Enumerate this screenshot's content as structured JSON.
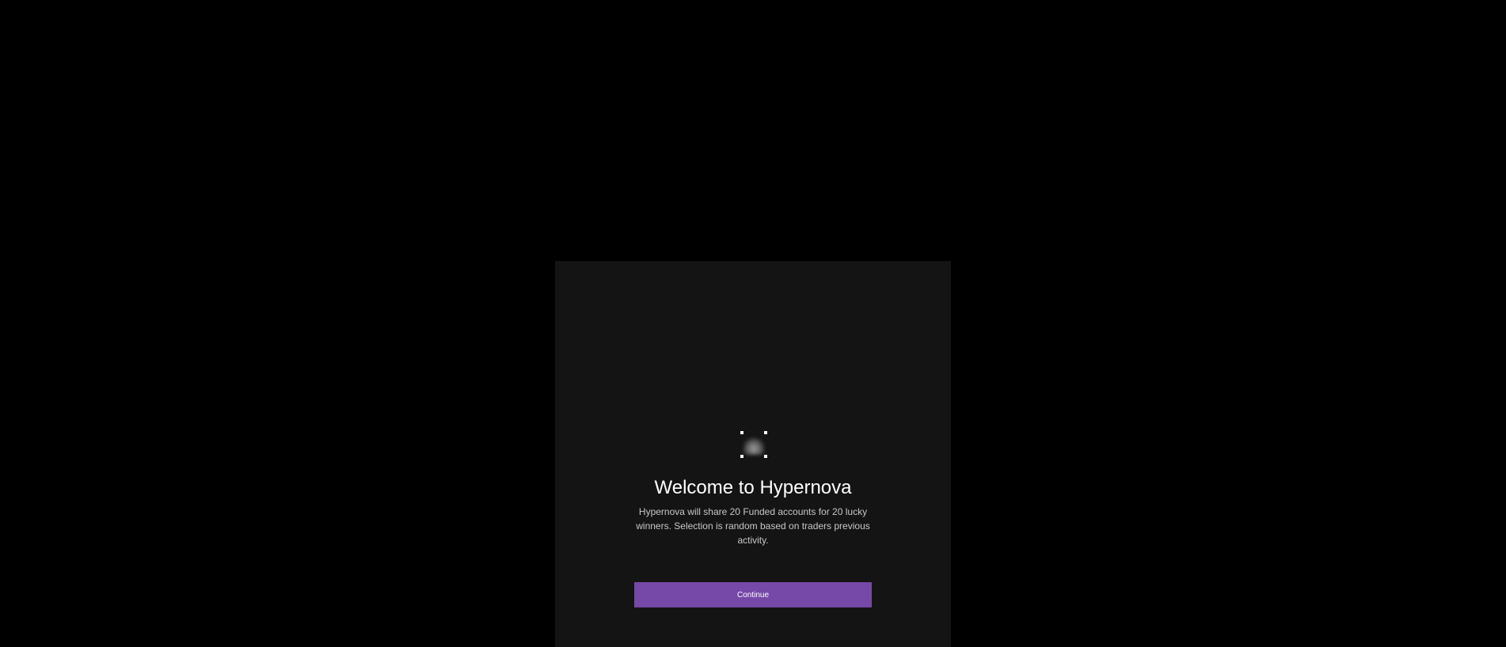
{
  "modal": {
    "logo_icon": "hypernova-logo-icon",
    "title": "Welcome to Hypernova",
    "description": "Hypernova will share 20 Funded accounts for 20 lucky winners. Selection is random based on traders previous activity.",
    "continue_label": "Continue"
  },
  "colors": {
    "page_background": "#000000",
    "panel_background": "#141414",
    "accent": "#7648a8"
  }
}
